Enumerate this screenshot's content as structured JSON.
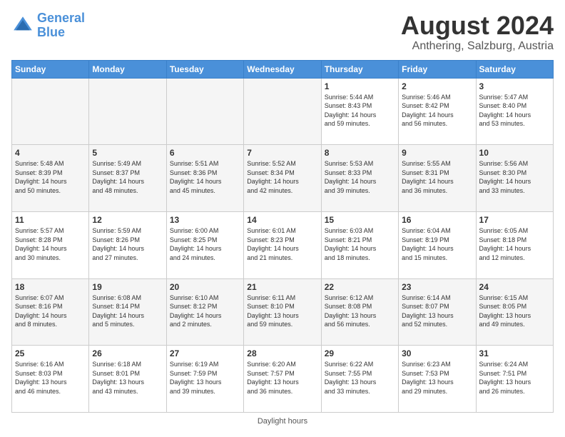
{
  "header": {
    "logo_line1": "General",
    "logo_line2": "Blue",
    "title": "August 2024",
    "subtitle": "Anthering, Salzburg, Austria"
  },
  "days_of_week": [
    "Sunday",
    "Monday",
    "Tuesday",
    "Wednesday",
    "Thursday",
    "Friday",
    "Saturday"
  ],
  "footer_text": "Daylight hours",
  "weeks": [
    [
      {
        "day": "",
        "info": ""
      },
      {
        "day": "",
        "info": ""
      },
      {
        "day": "",
        "info": ""
      },
      {
        "day": "",
        "info": ""
      },
      {
        "day": "1",
        "info": "Sunrise: 5:44 AM\nSunset: 8:43 PM\nDaylight: 14 hours\nand 59 minutes."
      },
      {
        "day": "2",
        "info": "Sunrise: 5:46 AM\nSunset: 8:42 PM\nDaylight: 14 hours\nand 56 minutes."
      },
      {
        "day": "3",
        "info": "Sunrise: 5:47 AM\nSunset: 8:40 PM\nDaylight: 14 hours\nand 53 minutes."
      }
    ],
    [
      {
        "day": "4",
        "info": "Sunrise: 5:48 AM\nSunset: 8:39 PM\nDaylight: 14 hours\nand 50 minutes."
      },
      {
        "day": "5",
        "info": "Sunrise: 5:49 AM\nSunset: 8:37 PM\nDaylight: 14 hours\nand 48 minutes."
      },
      {
        "day": "6",
        "info": "Sunrise: 5:51 AM\nSunset: 8:36 PM\nDaylight: 14 hours\nand 45 minutes."
      },
      {
        "day": "7",
        "info": "Sunrise: 5:52 AM\nSunset: 8:34 PM\nDaylight: 14 hours\nand 42 minutes."
      },
      {
        "day": "8",
        "info": "Sunrise: 5:53 AM\nSunset: 8:33 PM\nDaylight: 14 hours\nand 39 minutes."
      },
      {
        "day": "9",
        "info": "Sunrise: 5:55 AM\nSunset: 8:31 PM\nDaylight: 14 hours\nand 36 minutes."
      },
      {
        "day": "10",
        "info": "Sunrise: 5:56 AM\nSunset: 8:30 PM\nDaylight: 14 hours\nand 33 minutes."
      }
    ],
    [
      {
        "day": "11",
        "info": "Sunrise: 5:57 AM\nSunset: 8:28 PM\nDaylight: 14 hours\nand 30 minutes."
      },
      {
        "day": "12",
        "info": "Sunrise: 5:59 AM\nSunset: 8:26 PM\nDaylight: 14 hours\nand 27 minutes."
      },
      {
        "day": "13",
        "info": "Sunrise: 6:00 AM\nSunset: 8:25 PM\nDaylight: 14 hours\nand 24 minutes."
      },
      {
        "day": "14",
        "info": "Sunrise: 6:01 AM\nSunset: 8:23 PM\nDaylight: 14 hours\nand 21 minutes."
      },
      {
        "day": "15",
        "info": "Sunrise: 6:03 AM\nSunset: 8:21 PM\nDaylight: 14 hours\nand 18 minutes."
      },
      {
        "day": "16",
        "info": "Sunrise: 6:04 AM\nSunset: 8:19 PM\nDaylight: 14 hours\nand 15 minutes."
      },
      {
        "day": "17",
        "info": "Sunrise: 6:05 AM\nSunset: 8:18 PM\nDaylight: 14 hours\nand 12 minutes."
      }
    ],
    [
      {
        "day": "18",
        "info": "Sunrise: 6:07 AM\nSunset: 8:16 PM\nDaylight: 14 hours\nand 8 minutes."
      },
      {
        "day": "19",
        "info": "Sunrise: 6:08 AM\nSunset: 8:14 PM\nDaylight: 14 hours\nand 5 minutes."
      },
      {
        "day": "20",
        "info": "Sunrise: 6:10 AM\nSunset: 8:12 PM\nDaylight: 14 hours\nand 2 minutes."
      },
      {
        "day": "21",
        "info": "Sunrise: 6:11 AM\nSunset: 8:10 PM\nDaylight: 13 hours\nand 59 minutes."
      },
      {
        "day": "22",
        "info": "Sunrise: 6:12 AM\nSunset: 8:08 PM\nDaylight: 13 hours\nand 56 minutes."
      },
      {
        "day": "23",
        "info": "Sunrise: 6:14 AM\nSunset: 8:07 PM\nDaylight: 13 hours\nand 52 minutes."
      },
      {
        "day": "24",
        "info": "Sunrise: 6:15 AM\nSunset: 8:05 PM\nDaylight: 13 hours\nand 49 minutes."
      }
    ],
    [
      {
        "day": "25",
        "info": "Sunrise: 6:16 AM\nSunset: 8:03 PM\nDaylight: 13 hours\nand 46 minutes."
      },
      {
        "day": "26",
        "info": "Sunrise: 6:18 AM\nSunset: 8:01 PM\nDaylight: 13 hours\nand 43 minutes."
      },
      {
        "day": "27",
        "info": "Sunrise: 6:19 AM\nSunset: 7:59 PM\nDaylight: 13 hours\nand 39 minutes."
      },
      {
        "day": "28",
        "info": "Sunrise: 6:20 AM\nSunset: 7:57 PM\nDaylight: 13 hours\nand 36 minutes."
      },
      {
        "day": "29",
        "info": "Sunrise: 6:22 AM\nSunset: 7:55 PM\nDaylight: 13 hours\nand 33 minutes."
      },
      {
        "day": "30",
        "info": "Sunrise: 6:23 AM\nSunset: 7:53 PM\nDaylight: 13 hours\nand 29 minutes."
      },
      {
        "day": "31",
        "info": "Sunrise: 6:24 AM\nSunset: 7:51 PM\nDaylight: 13 hours\nand 26 minutes."
      }
    ]
  ]
}
